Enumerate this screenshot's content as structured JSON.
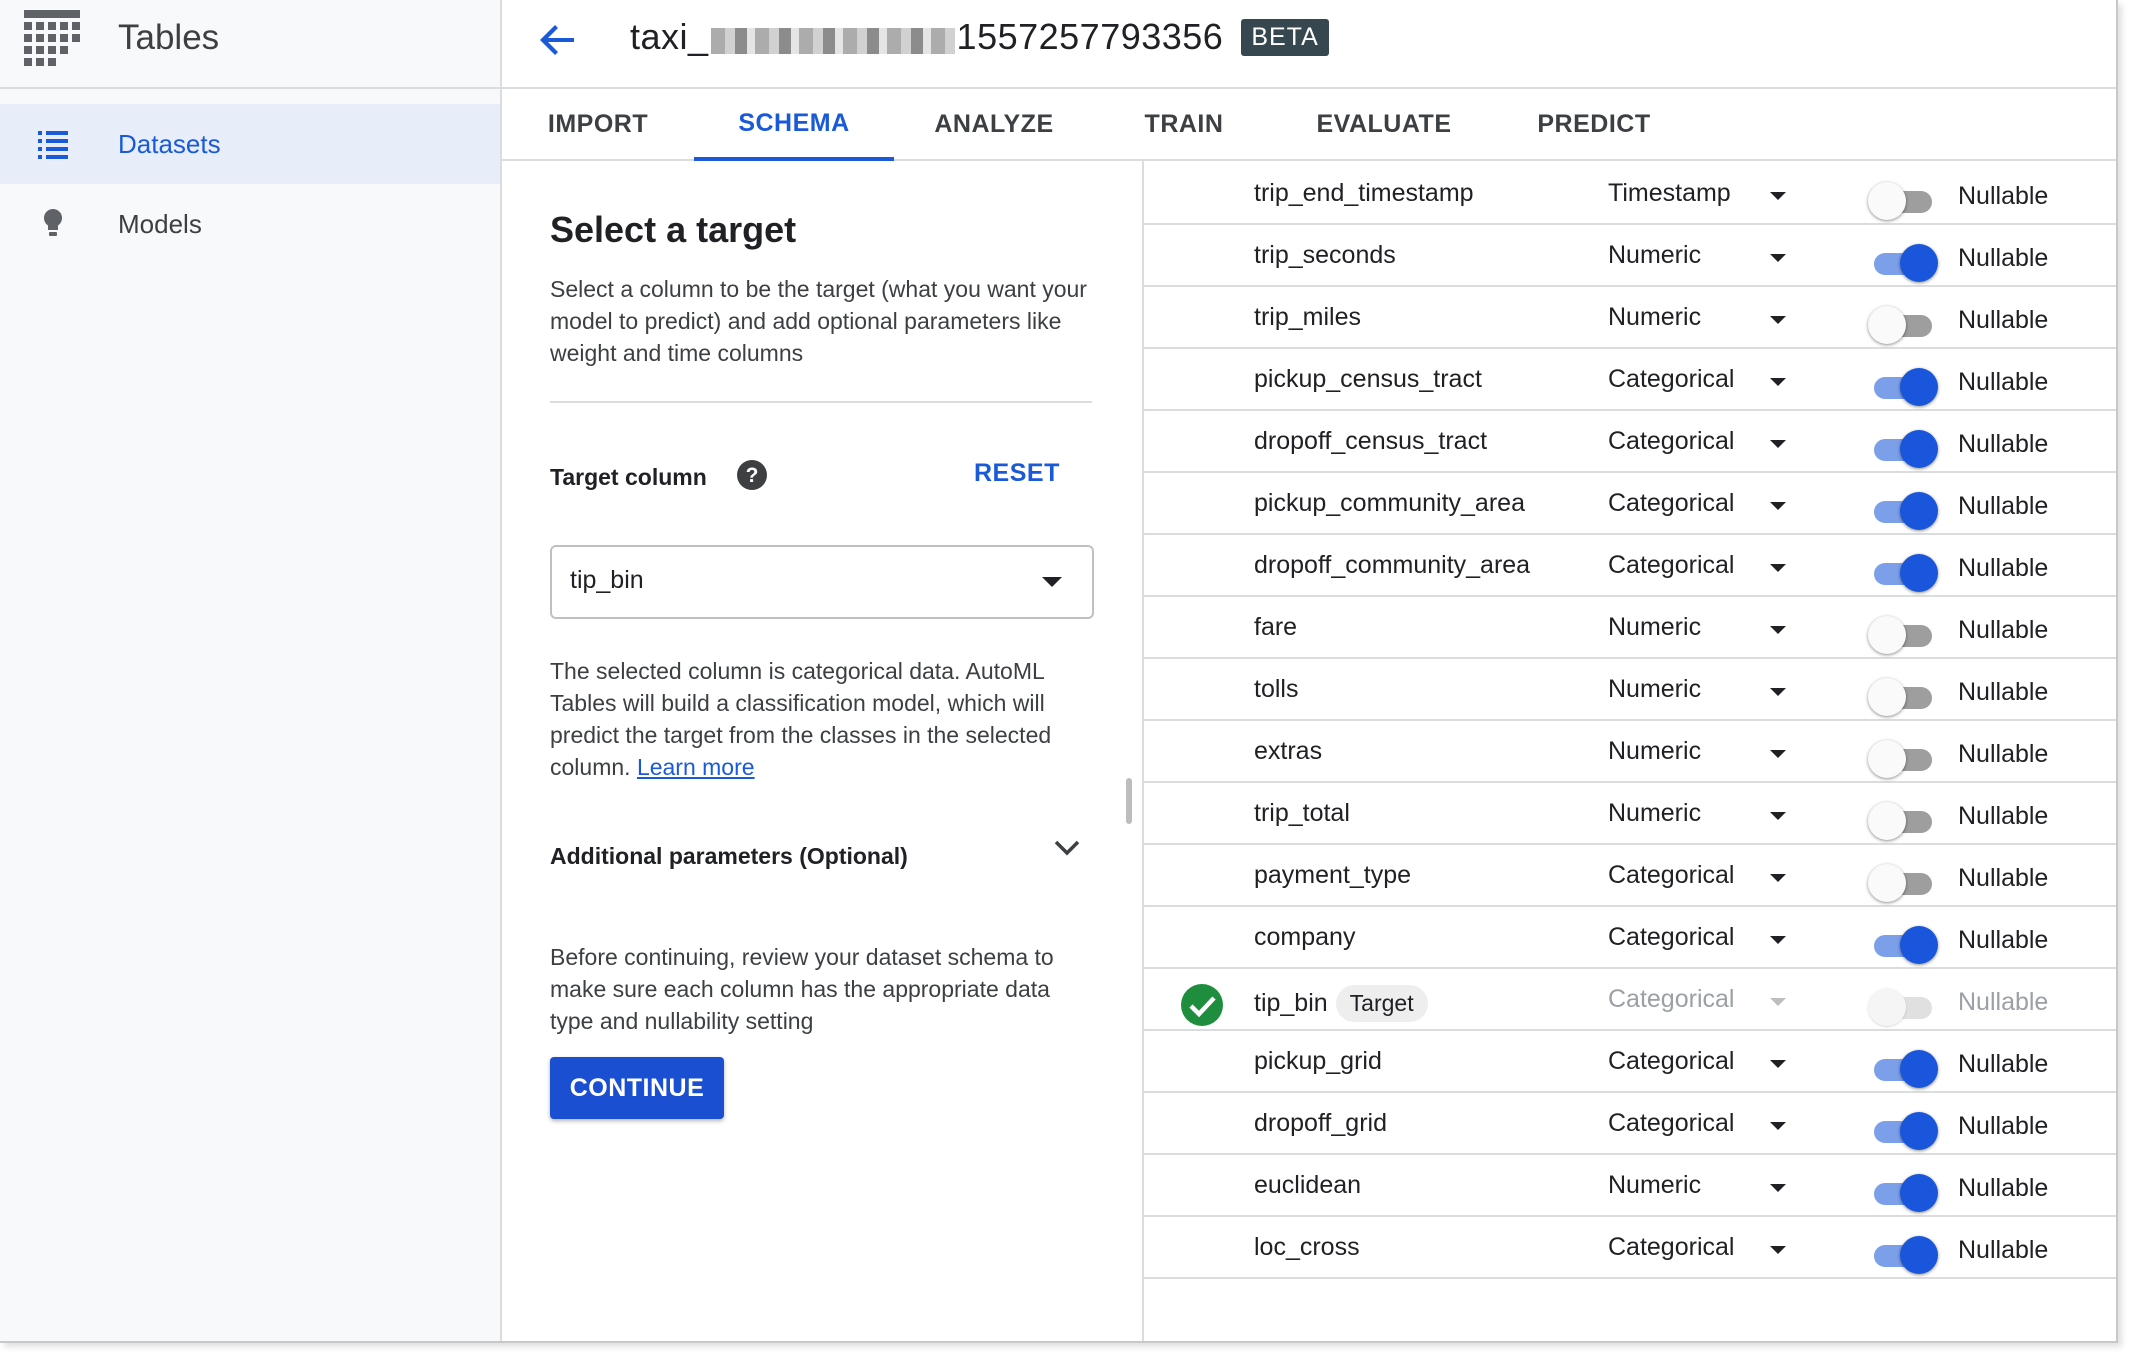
{
  "sidebar": {
    "app_title": "Tables",
    "brand_icon": "tables-grid-icon",
    "items": [
      {
        "label": "Datasets",
        "icon": "list-icon",
        "active": true
      },
      {
        "label": "Models",
        "icon": "lightbulb-icon",
        "active": false
      }
    ]
  },
  "header": {
    "title_prefix": "taxi_",
    "title_suffix": "1557257793356",
    "badge": "BETA"
  },
  "tabs": [
    {
      "label": "IMPORT",
      "active": false
    },
    {
      "label": "SCHEMA",
      "active": true
    },
    {
      "label": "ANALYZE",
      "active": false
    },
    {
      "label": "TRAIN",
      "active": false
    },
    {
      "label": "EVALUATE",
      "active": false
    },
    {
      "label": "PREDICT",
      "active": false
    }
  ],
  "panel": {
    "title": "Select a target",
    "description": "Select a column to be the target (what you want your model to predict) and add optional parameters like weight and time columns",
    "target_label": "Target column",
    "reset_label": "RESET",
    "selected_target": "tip_bin",
    "info_text": "The selected column is categorical data. AutoML Tables will build a classification model, which will predict the target from the classes in the selected column.",
    "learn_more": "Learn more",
    "additional_params": "Additional parameters (Optional)",
    "review_text": "Before continuing, review your dataset schema to make sure each column has the appropriate data type and nullability setting",
    "continue_label": "CONTINUE"
  },
  "schema": {
    "nullable_label": "Nullable",
    "target_badge": "Target",
    "rows": [
      {
        "name": "trip_end_timestamp",
        "type": "Timestamp",
        "nullable": false
      },
      {
        "name": "trip_seconds",
        "type": "Numeric",
        "nullable": true
      },
      {
        "name": "trip_miles",
        "type": "Numeric",
        "nullable": false
      },
      {
        "name": "pickup_census_tract",
        "type": "Categorical",
        "nullable": true
      },
      {
        "name": "dropoff_census_tract",
        "type": "Categorical",
        "nullable": true
      },
      {
        "name": "pickup_community_area",
        "type": "Categorical",
        "nullable": true
      },
      {
        "name": "dropoff_community_area",
        "type": "Categorical",
        "nullable": true
      },
      {
        "name": "fare",
        "type": "Numeric",
        "nullable": false
      },
      {
        "name": "tolls",
        "type": "Numeric",
        "nullable": false
      },
      {
        "name": "extras",
        "type": "Numeric",
        "nullable": false
      },
      {
        "name": "trip_total",
        "type": "Numeric",
        "nullable": false
      },
      {
        "name": "payment_type",
        "type": "Categorical",
        "nullable": false
      },
      {
        "name": "company",
        "type": "Categorical",
        "nullable": true
      },
      {
        "name": "tip_bin",
        "type": "Categorical",
        "nullable": false,
        "target": true
      },
      {
        "name": "pickup_grid",
        "type": "Categorical",
        "nullable": true
      },
      {
        "name": "dropoff_grid",
        "type": "Categorical",
        "nullable": true
      },
      {
        "name": "euclidean",
        "type": "Numeric",
        "nullable": true
      },
      {
        "name": "loc_cross",
        "type": "Categorical",
        "nullable": true
      }
    ]
  },
  "colors": {
    "accent": "#1a5ad8",
    "button": "#1a4fd1",
    "success": "#1e8e3e"
  }
}
